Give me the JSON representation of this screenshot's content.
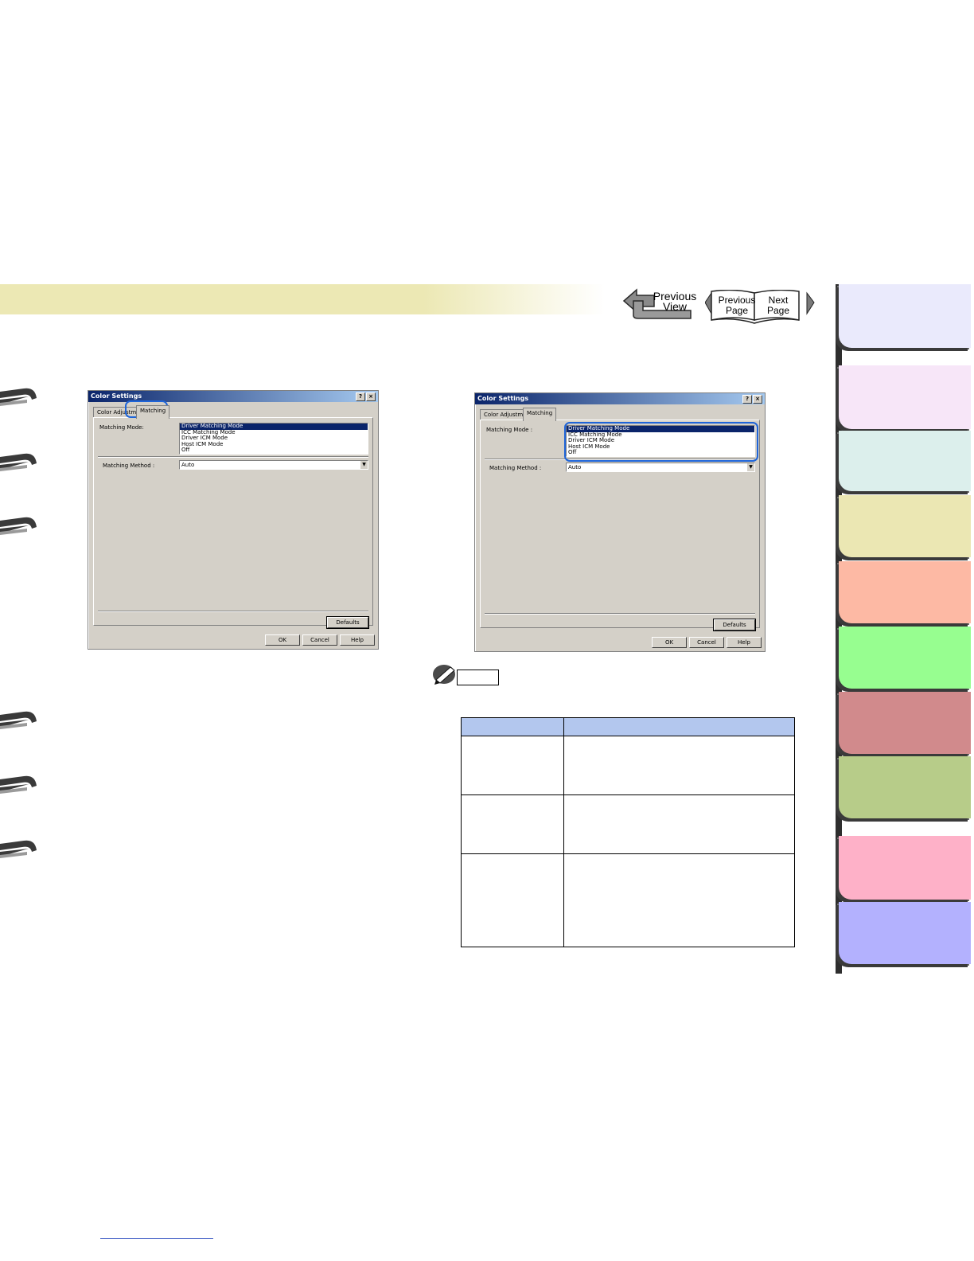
{
  "nav": {
    "previous_view_line1": "Previous",
    "previous_view_line2": "View",
    "previous_page_line1": "Previous",
    "previous_page_line2": "Page",
    "next_page_line1": "Next",
    "next_page_line2": "Page"
  },
  "side_tabs": {
    "colors": [
      "#eaeafc",
      "#f7e6f8",
      "#dcefec",
      "#ebe7b3",
      "#fdb9a4",
      "#97fe90",
      "#d18a8c",
      "#b7cc89",
      "#feb1c8",
      "#b3b1fe"
    ]
  },
  "dialog_left": {
    "title": "Color Settings",
    "help_btn": "?",
    "close_btn": "×",
    "tabs": [
      "Color Adjustment",
      "Matching"
    ],
    "matching_mode_label": "Matching Mode:",
    "modes": [
      "Driver Matching Mode",
      "ICC Matching Mode",
      "Driver ICM Mode",
      "Host ICM Mode",
      "Off"
    ],
    "matching_method_label": "Matching Method :",
    "matching_method_value": "Auto",
    "defaults_button": "Defaults",
    "ok_button": "OK",
    "cancel_button": "Cancel",
    "help_button": "Help"
  },
  "dialog_right": {
    "title": "Color Settings",
    "help_btn": "?",
    "close_btn": "×",
    "tabs": [
      "Color Adjustment",
      "Matching"
    ],
    "matching_mode_label": "Matching Mode :",
    "modes": [
      "Driver Matching Mode",
      "ICC Matching Mode",
      "Driver ICM Mode",
      "Host ICM Mode",
      "Off"
    ],
    "matching_method_label": "Matching Method :",
    "matching_method_value": "Auto",
    "defaults_button": "Defaults",
    "ok_button": "OK",
    "cancel_button": "Cancel",
    "help_button": "Help"
  }
}
